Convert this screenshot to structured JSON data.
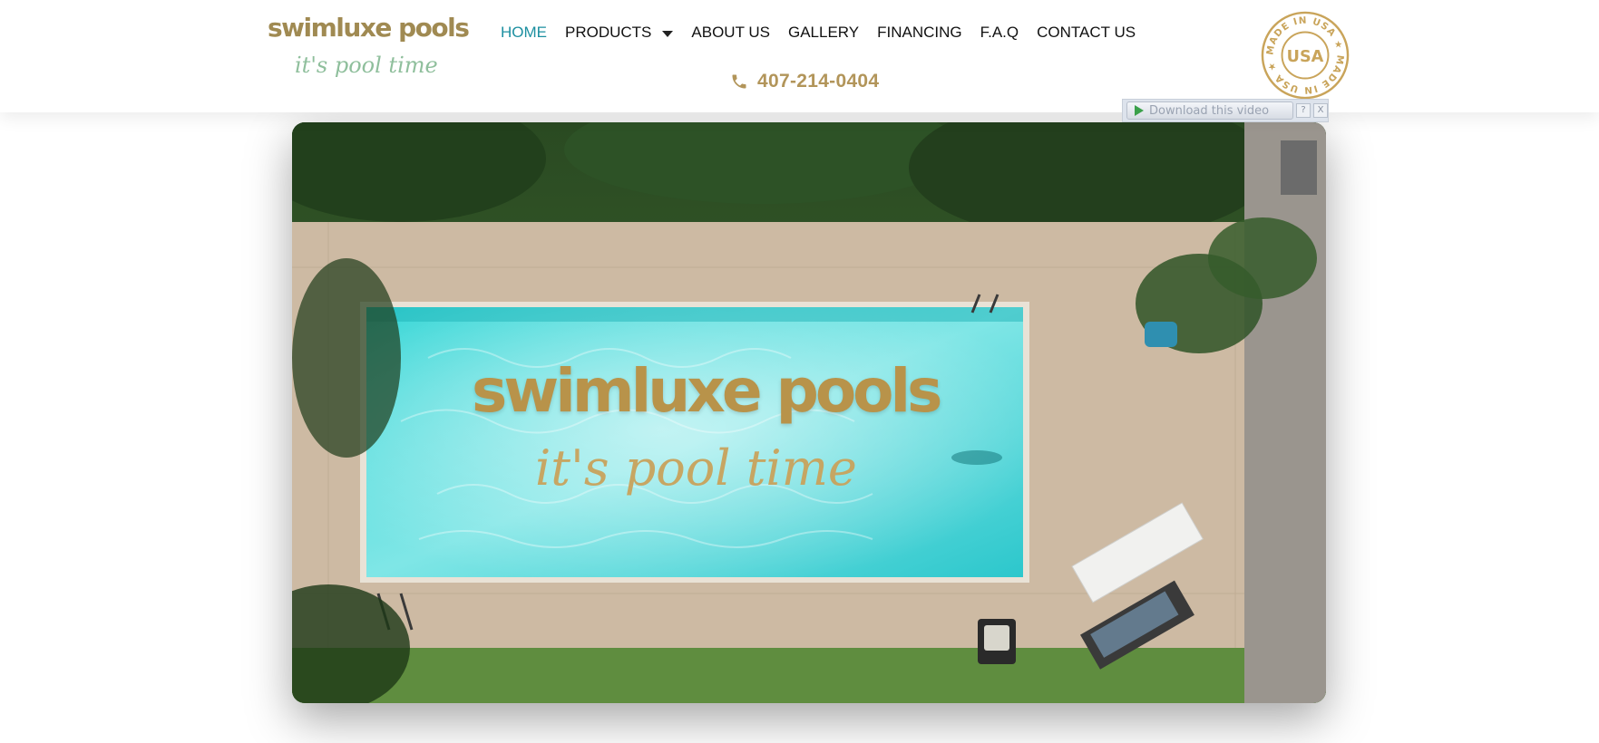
{
  "logo": {
    "name": "swimluxe pools",
    "tagline": "it's pool time"
  },
  "nav": {
    "items": [
      {
        "label": "HOME",
        "active": true
      },
      {
        "label": "PRODUCTS",
        "has_dropdown": true
      },
      {
        "label": "ABOUT US"
      },
      {
        "label": "GALLERY"
      },
      {
        "label": "FINANCING"
      },
      {
        "label": "F.A.Q"
      },
      {
        "label": "CONTACT US"
      }
    ]
  },
  "phone": {
    "number": "407-214-0404",
    "icon": "phone-icon"
  },
  "badge": {
    "icon": "made-in-usa-seal",
    "center_text": "USA",
    "ring_text": "MADE IN USA ★ MADE IN USA ★"
  },
  "video_overlay": {
    "brand": "swimluxe pools",
    "tagline": "it's pool time"
  },
  "download_bar": {
    "label": "Download this video",
    "help": "?",
    "close": "X"
  },
  "colors": {
    "gold": "#b2955a",
    "nav_active": "#1c8fa0",
    "tagline_green": "#8fbf9c"
  }
}
